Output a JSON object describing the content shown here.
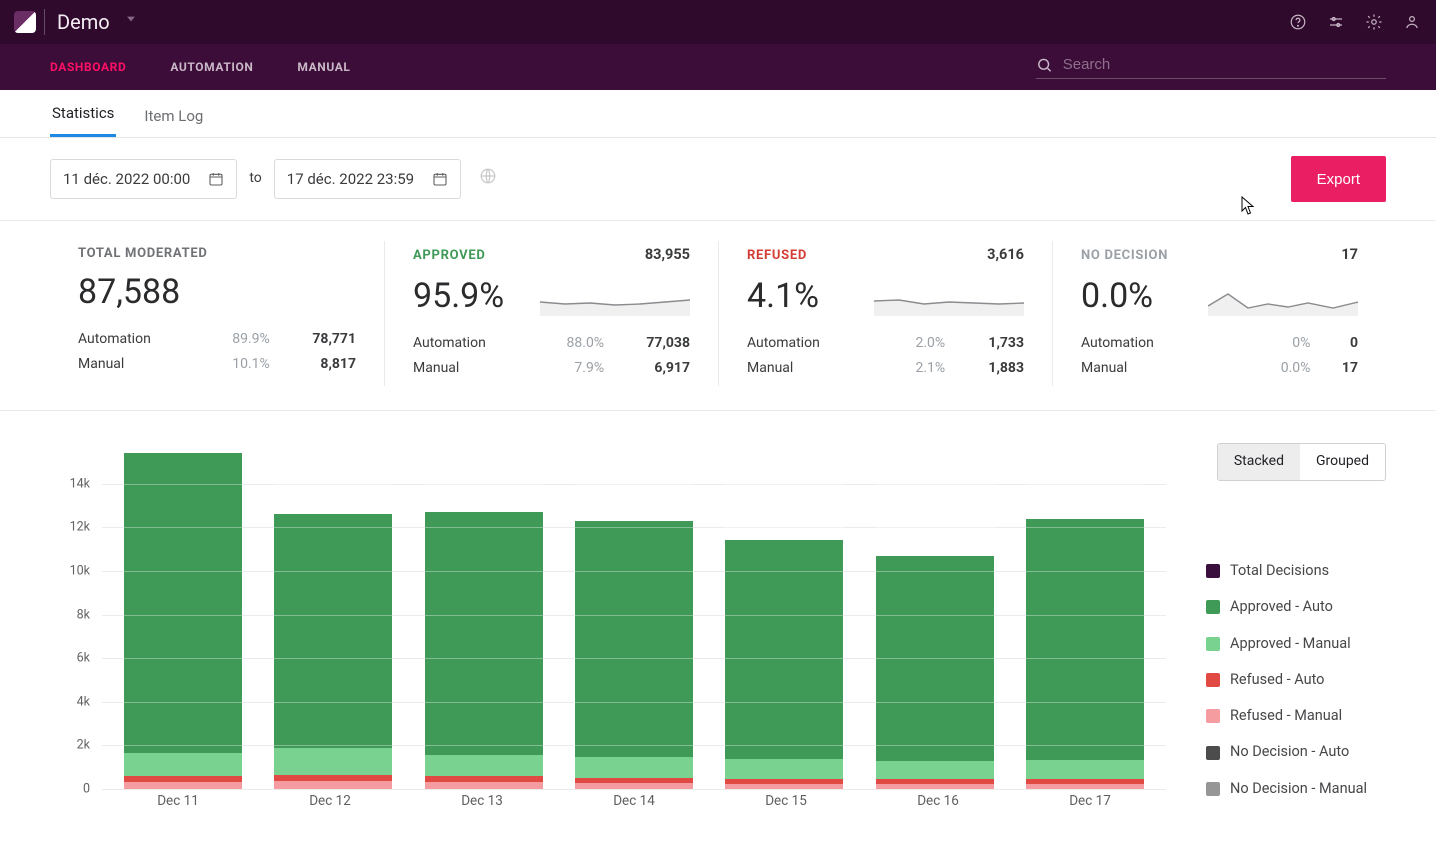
{
  "brand": "Demo",
  "nav": {
    "tabs": [
      "DASHBOARD",
      "AUTOMATION",
      "MANUAL"
    ],
    "active": 0,
    "search_placeholder": "Search"
  },
  "subtabs": {
    "items": [
      "Statistics",
      "Item Log"
    ],
    "active": 0
  },
  "filters": {
    "from": "11 déc. 2022 00:00",
    "to_label": "to",
    "to": "17 déc. 2022 23:59",
    "export": "Export"
  },
  "kpis": {
    "total": {
      "title": "TOTAL MODERATED",
      "big": "87,588",
      "rows": [
        {
          "l": "Automation",
          "p": "89.9%",
          "v": "78,771"
        },
        {
          "l": "Manual",
          "p": "10.1%",
          "v": "8,817"
        }
      ]
    },
    "approved": {
      "title": "APPROVED",
      "count": "83,955",
      "big": "95.9%",
      "rows": [
        {
          "l": "Automation",
          "p": "88.0%",
          "v": "77,038"
        },
        {
          "l": "Manual",
          "p": "7.9%",
          "v": "6,917"
        }
      ]
    },
    "refused": {
      "title": "REFUSED",
      "count": "3,616",
      "big": "4.1%",
      "rows": [
        {
          "l": "Automation",
          "p": "2.0%",
          "v": "1,733"
        },
        {
          "l": "Manual",
          "p": "2.1%",
          "v": "1,883"
        }
      ]
    },
    "nodec": {
      "title": "NO DECISION",
      "count": "17",
      "big": "0.0%",
      "rows": [
        {
          "l": "Automation",
          "p": "0%",
          "v": "0"
        },
        {
          "l": "Manual",
          "p": "0.0%",
          "v": "17"
        }
      ]
    }
  },
  "chart_toggle": {
    "stacked": "Stacked",
    "grouped": "Grouped",
    "active": "stacked"
  },
  "legend": [
    {
      "label": "Total Decisions",
      "color": "#3a0f3d"
    },
    {
      "label": "Approved - Auto",
      "color": "#3f9a58"
    },
    {
      "label": "Approved - Manual",
      "color": "#79d290"
    },
    {
      "label": "Refused - Auto",
      "color": "#e14a43"
    },
    {
      "label": "Refused - Manual",
      "color": "#f49ca0"
    },
    {
      "label": "No Decision - Auto",
      "color": "#4c4c4c"
    },
    {
      "label": "No Decision - Manual",
      "color": "#969696"
    }
  ],
  "chart_data": {
    "type": "bar",
    "stacked": true,
    "ylabel": "",
    "xlabel": "",
    "ylim": [
      0,
      15500
    ],
    "yticks": [
      0,
      2000,
      4000,
      6000,
      8000,
      10000,
      12000,
      14000
    ],
    "ytick_labels": [
      "0",
      "2k",
      "4k",
      "6k",
      "8k",
      "10k",
      "12k",
      "14k"
    ],
    "categories": [
      "Dec 11",
      "Dec 12",
      "Dec 13",
      "Dec 14",
      "Dec 15",
      "Dec 16",
      "Dec 17"
    ],
    "series": [
      {
        "name": "Refused - Manual",
        "color": "#f49ca0",
        "values": [
          300,
          350,
          300,
          260,
          250,
          230,
          240
        ]
      },
      {
        "name": "Refused - Auto",
        "color": "#e14a43",
        "values": [
          280,
          300,
          280,
          240,
          230,
          210,
          220
        ]
      },
      {
        "name": "Approved - Manual",
        "color": "#79d290",
        "values": [
          1050,
          1250,
          1000,
          980,
          900,
          830,
          870
        ]
      },
      {
        "name": "Approved - Auto",
        "color": "#3f9a58",
        "values": [
          13770,
          10700,
          11120,
          10820,
          10020,
          9430,
          11070
        ]
      },
      {
        "name": "No Decision - Manual",
        "color": "#969696",
        "values": [
          3,
          3,
          2,
          3,
          2,
          2,
          2
        ]
      },
      {
        "name": "No Decision - Auto",
        "color": "#4c4c4c",
        "values": [
          0,
          0,
          0,
          0,
          0,
          0,
          0
        ]
      }
    ],
    "totals": [
      15400,
      12600,
      12700,
      12300,
      11400,
      10700,
      12400
    ]
  }
}
